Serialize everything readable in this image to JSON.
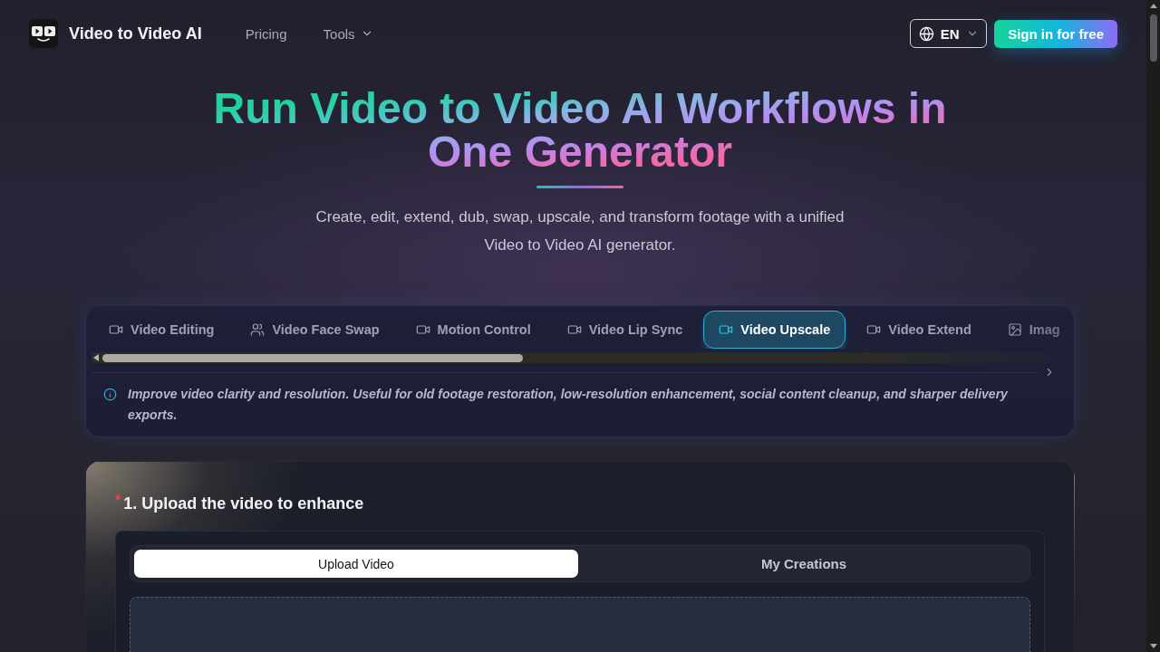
{
  "header": {
    "brand": "Video to Video AI",
    "nav": [
      {
        "label": "Pricing",
        "kind": "link"
      },
      {
        "label": "Tools",
        "kind": "menu"
      }
    ],
    "language": "EN",
    "sign_in": "Sign in for free"
  },
  "hero": {
    "title": "Run Video to Video AI Workflows in One Generator",
    "subtitle": "Create, edit, extend, dub, swap, upscale, and transform footage with a unified Video to Video AI generator."
  },
  "tool_tabs": {
    "tabs": [
      {
        "label": "Video Editing",
        "kind": "video",
        "selected": false
      },
      {
        "label": "Video Face Swap",
        "kind": "people",
        "selected": false
      },
      {
        "label": "Motion Control",
        "kind": "video",
        "selected": false
      },
      {
        "label": "Video Lip Sync",
        "kind": "video",
        "selected": false
      },
      {
        "label": "Video Upscale",
        "kind": "video",
        "selected": true
      },
      {
        "label": "Video Extend",
        "kind": "video",
        "selected": false
      },
      {
        "label": "Imag",
        "kind": "image",
        "selected": false
      }
    ],
    "description": "Improve video clarity and resolution. Useful for old footage restoration, low-resolution enhancement, social content cleanup, and sharper delivery exports."
  },
  "upload": {
    "required": true,
    "required_mark": "*",
    "step": "1. Upload the video to enhance",
    "sources": [
      {
        "label": "Upload Video",
        "selected": true
      },
      {
        "label": "My Creations",
        "selected": false
      }
    ]
  }
}
